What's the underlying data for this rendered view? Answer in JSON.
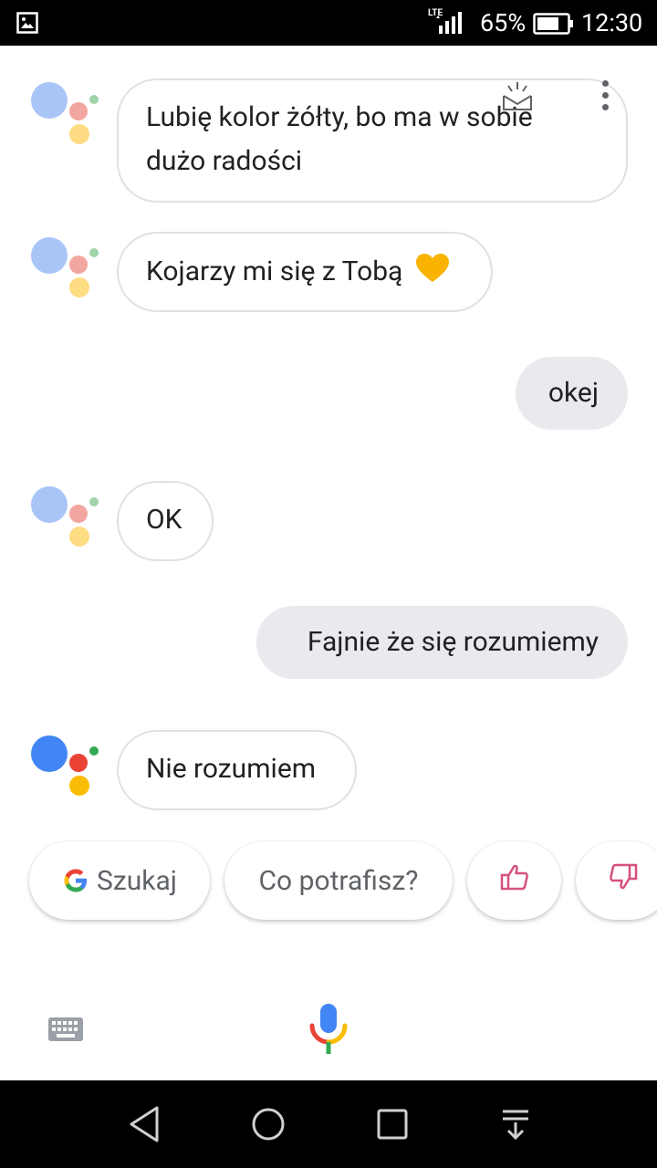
{
  "status_bar": {
    "network": "LTE",
    "battery_percent": "65%",
    "time": "12:30"
  },
  "conversation": {
    "assistant_1": "Lubię kolor żółty, bo ma w sobie dużo radości",
    "assistant_2": "Kojarzy mi się z Tobą",
    "user_1": "okej",
    "assistant_3": "OK",
    "user_2": "Fajnie że się rozumiemy",
    "assistant_4": "Nie rozumiem"
  },
  "suggestions": {
    "search": "Szukaj",
    "capabilities": "Co potrafisz?"
  },
  "icons": {
    "heart": "yellow-heart-icon",
    "thumbs_up": "thumbs-up-icon",
    "thumbs_down": "thumbs-down-icon",
    "keyboard": "keyboard-icon",
    "mic": "microphone-icon"
  },
  "colors": {
    "google_blue": "#4285F4",
    "google_red": "#EA4335",
    "google_yellow": "#FBBC05",
    "google_green": "#34A853",
    "feedback_pink": "#d6517a",
    "heart_yellow": "#F9B300"
  }
}
